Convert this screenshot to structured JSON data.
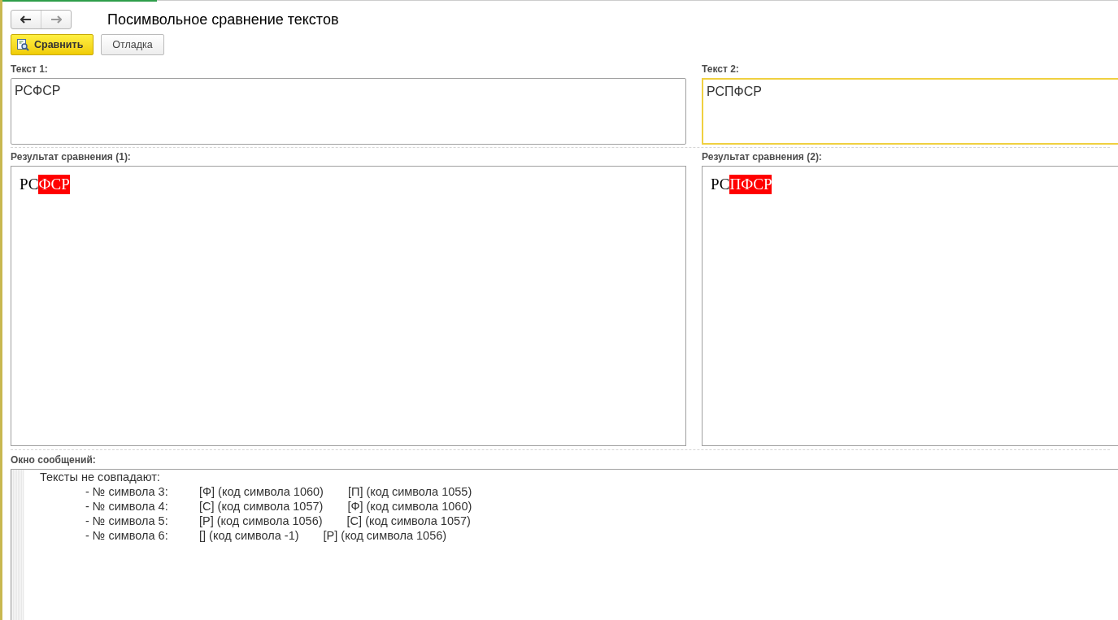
{
  "window": {
    "title": "Посимвольное сравнение текстов"
  },
  "toolbar": [
    {
      "label": "Сравнить",
      "kind": "primary"
    },
    {
      "label": "Отладка",
      "kind": "plain"
    }
  ],
  "inputs": [
    {
      "label": "Текст 1:",
      "value": "РСФСР",
      "focused": false
    },
    {
      "label": "Текст 2:",
      "value": "РСПФСР",
      "focused": true
    }
  ],
  "results": [
    {
      "label": "Результат сравнения (1):",
      "segments": [
        {
          "text": "РС",
          "highlighted": false
        },
        {
          "text": "ФСР",
          "highlighted": true
        }
      ]
    },
    {
      "label": "Результат сравнения (2):",
      "segments": [
        {
          "text": "РС",
          "highlighted": false
        },
        {
          "text": "ПФСР",
          "highlighted": true
        }
      ]
    }
  ],
  "messages": {
    "label": "Окно сообщений:",
    "heading": "Тексты не совпадают:",
    "rows": [
      [
        "- № символа 3:",
        "[Ф] (код символа 1060)",
        "[П] (код символа 1055)"
      ],
      [
        "- № символа 4:",
        "[С] (код символа 1057)",
        "[Ф] (код символа 1060)"
      ],
      [
        "- № символа 5:",
        "[Р] (код символа 1056)",
        "[С] (код символа 1057)"
      ],
      [
        "- № символа 6:",
        "[] (код символа -1)",
        "[Р] (код символа 1056)"
      ]
    ]
  }
}
